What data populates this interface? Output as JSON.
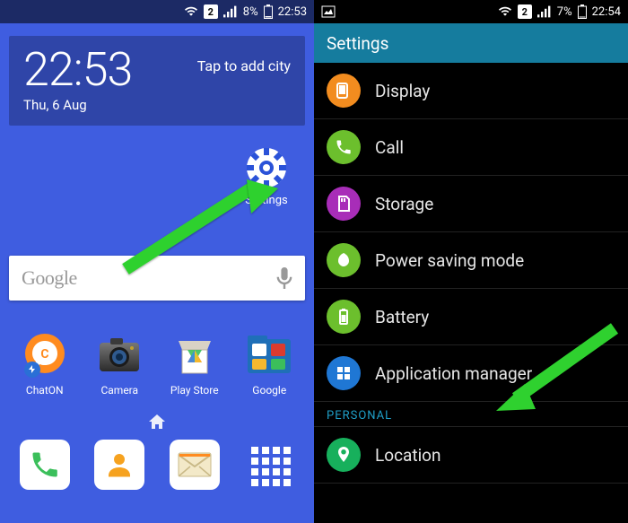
{
  "left": {
    "statusbar": {
      "sim": "2",
      "battery_pct": "8%",
      "time": "22:53"
    },
    "clock": {
      "time": "22:53",
      "date": "Thu, 6 Aug",
      "city_prompt": "Tap to add city"
    },
    "settings_label": "Settings",
    "search_placeholder": "Google",
    "apps": {
      "chaton": "ChatON",
      "camera": "Camera",
      "playstore": "Play Store",
      "google": "Google"
    }
  },
  "right": {
    "statusbar": {
      "sim": "2",
      "battery_pct": "7%",
      "time": "22:54"
    },
    "header": "Settings",
    "items": {
      "display": "Display",
      "call": "Call",
      "storage": "Storage",
      "power": "Power saving mode",
      "battery": "Battery",
      "appmgr": "Application manager",
      "location": "Location"
    },
    "section_personal": "PERSONAL"
  }
}
